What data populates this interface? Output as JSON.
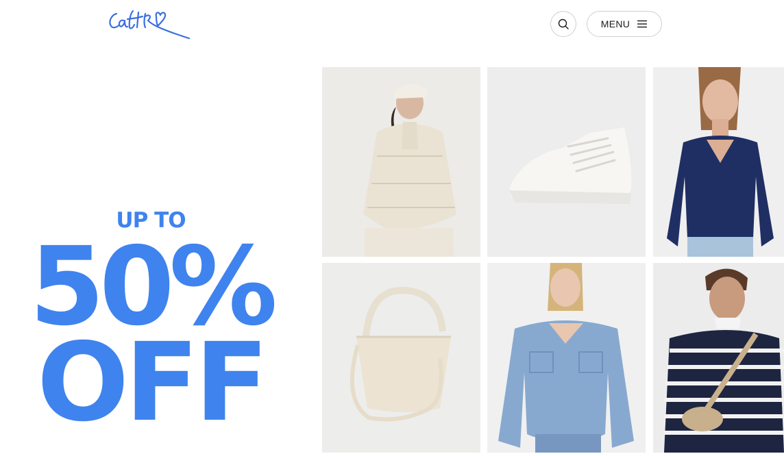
{
  "brand": {
    "logo_text": "castro"
  },
  "header": {
    "search_icon": "search-icon",
    "menu_label": "MENU",
    "menu_icon": "hamburger-icon"
  },
  "promo": {
    "line1": "UP TO",
    "line2": "50%",
    "line3": "OFF",
    "color": "#3f83ee"
  },
  "products": [
    {
      "item": "cream-puffer-jacket"
    },
    {
      "item": "white-high-top-sneaker"
    },
    {
      "item": "navy-ribbed-top"
    },
    {
      "item": "cream-shoulder-bag"
    },
    {
      "item": "denim-shirt"
    },
    {
      "item": "striped-sweater"
    }
  ]
}
